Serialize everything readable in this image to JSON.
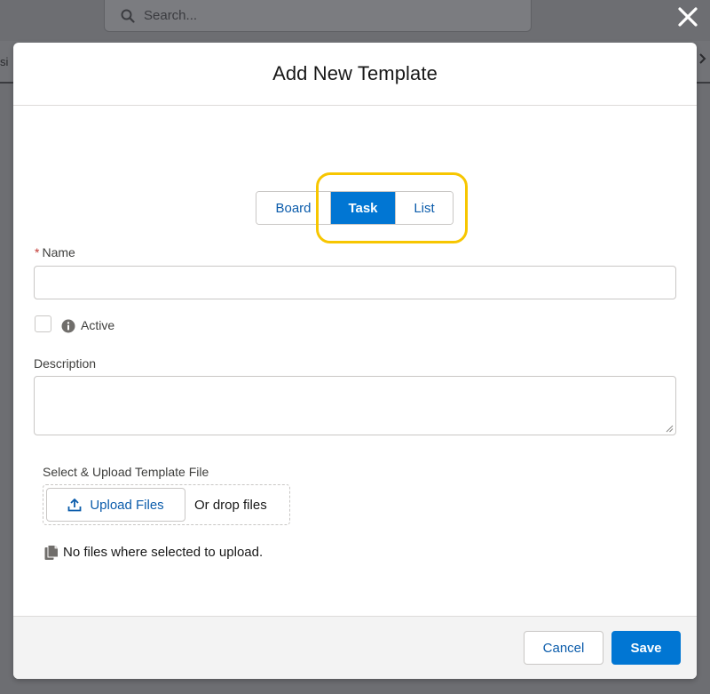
{
  "background": {
    "search_placeholder": "Search...",
    "tab_fragment": "si"
  },
  "icons": {
    "close": "close-icon",
    "search": "search-icon",
    "info": "info-icon",
    "upload": "upload-icon",
    "file": "file-icon"
  },
  "colors": {
    "brand": "#0176d3",
    "highlight": "#f7c600",
    "required": "#c23934"
  },
  "modal": {
    "title": "Add New Template",
    "view_toggle": {
      "options": [
        "Board",
        "Task",
        "List"
      ],
      "selected": "Task"
    },
    "name": {
      "required_mark": "*",
      "label": "Name",
      "value": ""
    },
    "active": {
      "label": "Active",
      "checked": false
    },
    "description": {
      "label": "Description",
      "value": ""
    },
    "upload": {
      "label": "Select & Upload Template File",
      "button_label": "Upload Files",
      "drop_text": "Or drop files",
      "status": "No files where selected to upload."
    },
    "footer": {
      "cancel_label": "Cancel",
      "save_label": "Save"
    }
  }
}
